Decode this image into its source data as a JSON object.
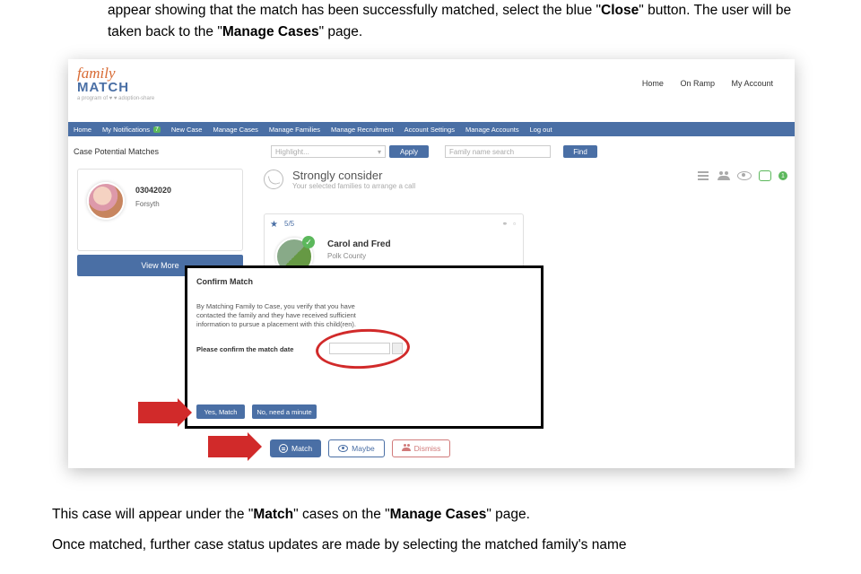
{
  "doc": {
    "top_line1_a": "appear showing that the match has been successfully matched, select the blue \"",
    "top_line1_close": "Close",
    "top_line1_b": "\" button.",
    "top_line2_a": "The user will be taken back to the \"",
    "top_line2_manage": "Manage Cases",
    "top_line2_b": "\" page.",
    "bottom_p1_a": "This case will appear under the \"",
    "bottom_p1_match": "Match",
    "bottom_p1_b": "\" cases on the \"",
    "bottom_p1_manage": "Manage Cases",
    "bottom_p1_c": "\" page.",
    "bottom_p2": "Once matched, further case status updates are made by selecting the matched family's name"
  },
  "logo": {
    "l1": "family",
    "l2": "MATCH",
    "l3": "a program of ♥ ♥ adoption-share"
  },
  "top_nav": {
    "home": "Home",
    "onramp": "On Ramp",
    "account": "My Account"
  },
  "nav": {
    "home": "Home",
    "notif": "My Notifications",
    "notif_badge": "7",
    "newcase": "New Case",
    "managecases": "Manage Cases",
    "managefam": "Manage Families",
    "managerec": "Manage Recruitment",
    "acct": "Account Settings",
    "manageacct": "Manage Accounts",
    "logout": "Log out"
  },
  "filter": {
    "title": "Case Potential Matches",
    "highlight": "Highlight...",
    "apply": "Apply",
    "fam_placeholder": "Family name search",
    "find": "Find"
  },
  "case": {
    "id": "03042020",
    "sub": "Forsyth",
    "viewmore": "View More"
  },
  "consider": {
    "title": "Strongly consider",
    "sub": "Your selected families to arrange a call",
    "thumb_count": "1"
  },
  "family": {
    "star": "★",
    "score": "5/5",
    "name": "Carol and Fred",
    "loc": "Polk County"
  },
  "modal": {
    "title": "Confirm Match",
    "par": "By Matching Family to Case, you verify that you have contacted the family and they have received sufficient information to pursue a placement with this child(ren).",
    "date_lbl": "Please confirm the match date",
    "yes": "Yes, Match",
    "no": "No, need a minute"
  },
  "btns": {
    "match": "Match",
    "maybe": "Maybe",
    "dismiss": "Dismiss"
  }
}
